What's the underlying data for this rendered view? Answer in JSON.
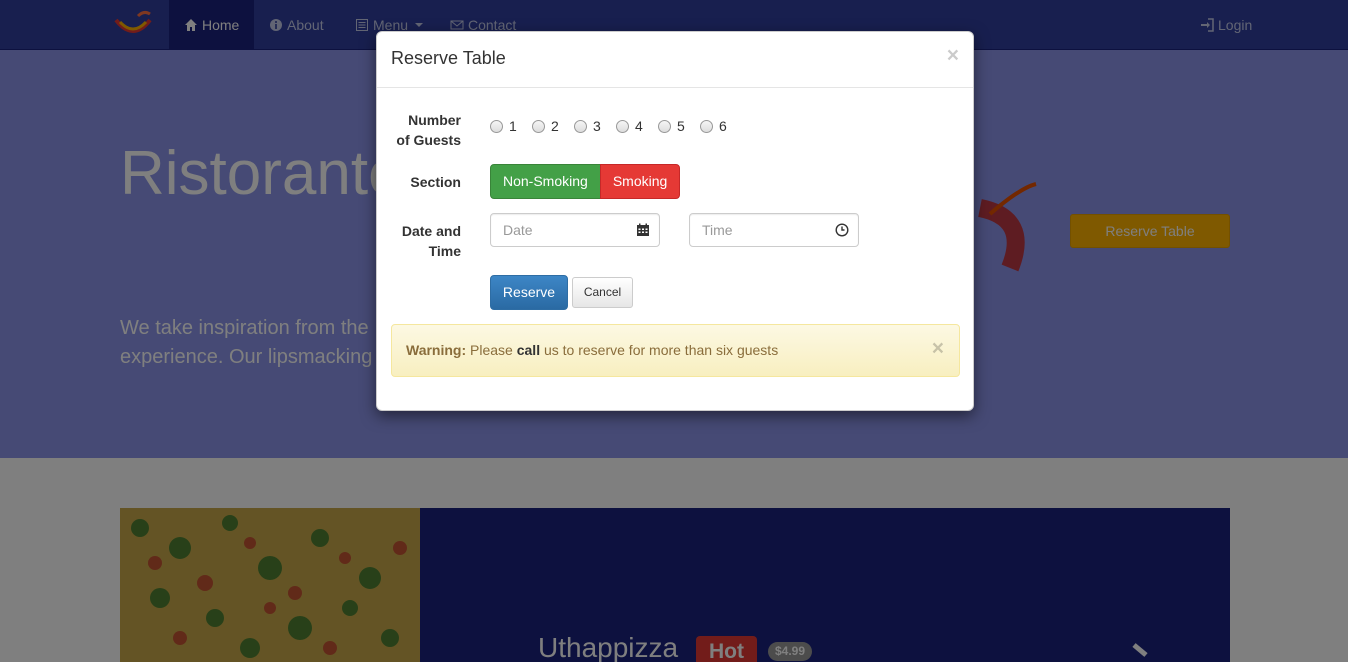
{
  "navbar": {
    "items": [
      {
        "label": "Home",
        "icon": "home-icon"
      },
      {
        "label": "About",
        "icon": "info-icon"
      },
      {
        "label": "Menu",
        "icon": "list-icon"
      },
      {
        "label": "Contact",
        "icon": "envelope-icon"
      }
    ],
    "login_label": "Login"
  },
  "jumbotron": {
    "title": "Ristorante",
    "text_line1": "We take inspiration from the",
    "text_line2": "experience. Our lipsmacking",
    "button_label": "Reserve Table"
  },
  "featured": {
    "dish_name": "Uthappizza",
    "badge": "Hot",
    "price": "$4.99"
  },
  "modal": {
    "title": "Reserve Table",
    "close": "×",
    "guests_label_line1": "Number",
    "guests_label_line2": "of Guests",
    "guest_options": [
      "1",
      "2",
      "3",
      "4",
      "5",
      "6"
    ],
    "section_label": "Section",
    "section_options": [
      "Non-Smoking",
      "Smoking"
    ],
    "datetime_label_line1": "Date and",
    "datetime_label_line2": "Time",
    "date_placeholder": "Date",
    "time_placeholder": "Time",
    "reserve_label": "Reserve",
    "cancel_label": "Cancel",
    "alert": {
      "prefix": "Warning:",
      "text_before": "Please",
      "emphasis": "call",
      "text_after": "us to reserve for more than six guests",
      "close": "×"
    }
  },
  "colors": {
    "navbar": "#303f9f",
    "jumbotron": "#8c95ea",
    "non_smoking": "#43a047",
    "smoking": "#e53935",
    "reserve": "#337ab7",
    "warning_bg": "#fcf8e3"
  }
}
